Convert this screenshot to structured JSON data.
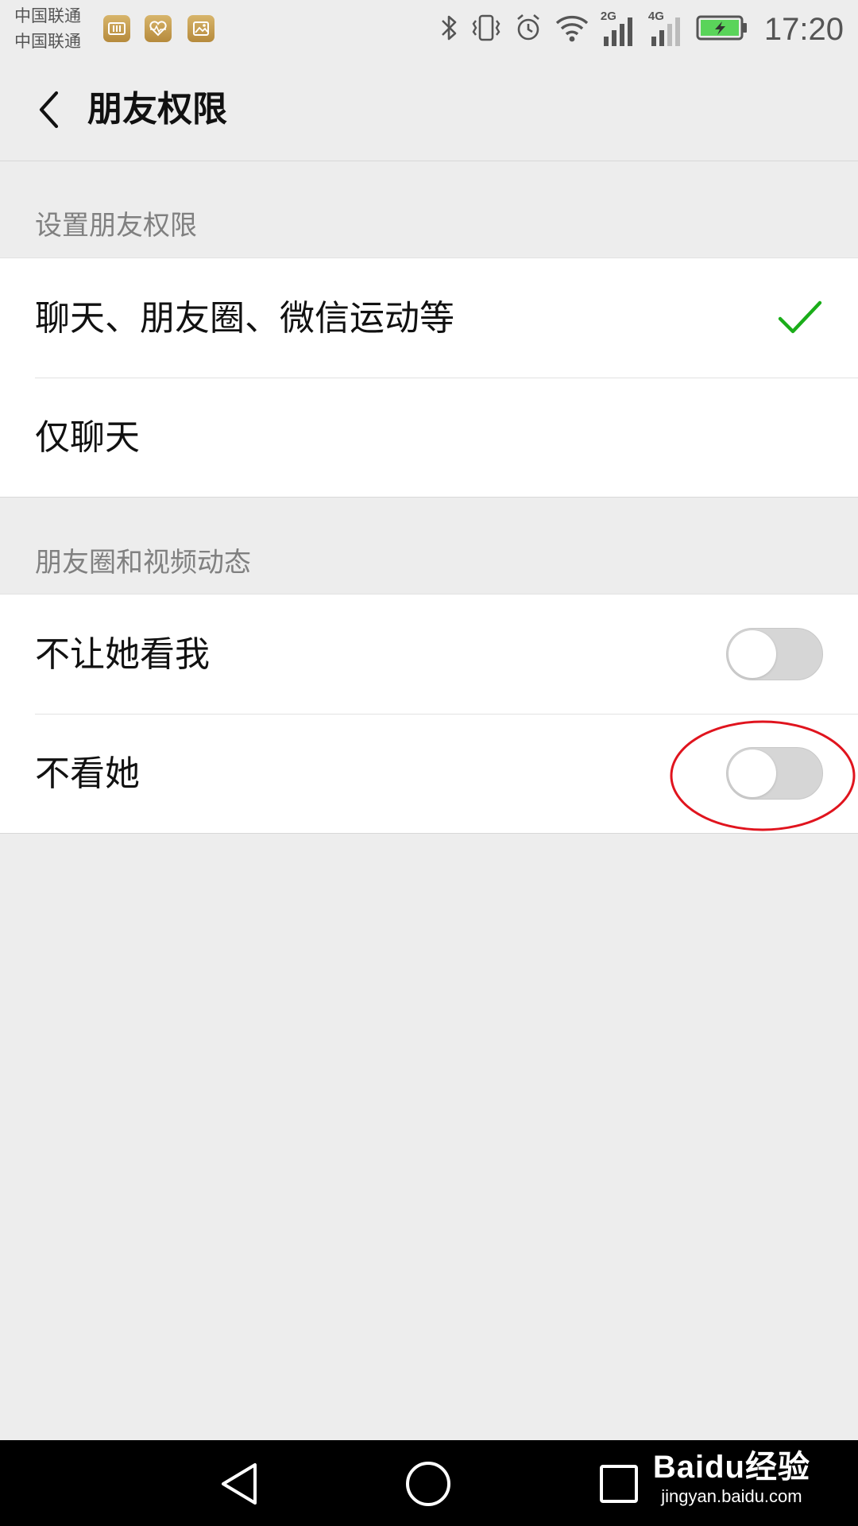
{
  "status_bar": {
    "carrier_1": "中国联通",
    "carrier_2": "中国联通",
    "network_1": "2G",
    "network_2": "4G",
    "time": "17:20"
  },
  "header": {
    "title": "朋友权限"
  },
  "sections": {
    "permissions": {
      "header": "设置朋友权限",
      "items": [
        {
          "label": "聊天、朋友圈、微信运动等",
          "selected": true
        },
        {
          "label": "仅聊天",
          "selected": false
        }
      ]
    },
    "moments": {
      "header": "朋友圈和视频动态",
      "items": [
        {
          "label": "不让她看我",
          "enabled": false
        },
        {
          "label": "不看她",
          "enabled": false
        }
      ]
    }
  },
  "watermark": {
    "main": "Baidu经验",
    "sub": "jingyan.baidu.com"
  },
  "colors": {
    "accent_green": "#1aad19",
    "annotation_red": "#e0141e",
    "background": "#ededed"
  }
}
